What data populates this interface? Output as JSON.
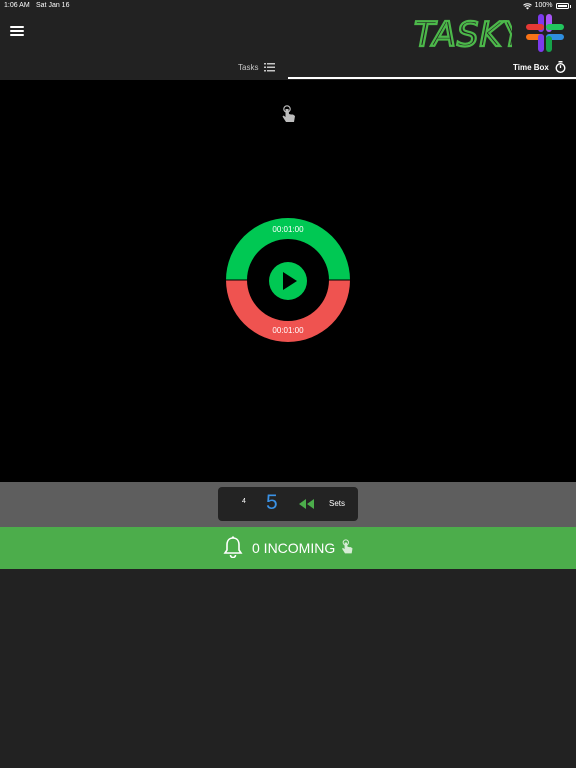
{
  "status_bar": {
    "time": "1:06 AM",
    "date": "Sat Jan 16",
    "battery": "100%"
  },
  "header": {
    "menu_icon": "hamburger-menu-icon",
    "logo_text": "TASKY",
    "logo_icon": "colorful-hash-logo-icon"
  },
  "tabs": [
    {
      "label": "Tasks",
      "icon": "list-icon",
      "selected": false
    },
    {
      "label": "Time Box",
      "icon": "stopwatch-icon",
      "selected": true
    }
  ],
  "timer": {
    "top_time": "00:01:00",
    "bottom_time": "00:01:00",
    "top_color": "#00c853",
    "bottom_color": "#ef5350",
    "play_icon": "play-icon",
    "tap_hint_icon": "tap-hand-icon"
  },
  "sets": {
    "previous": "4",
    "current": "5",
    "label": "Sets",
    "rewind_icon": "rewind-icon"
  },
  "incoming": {
    "text": "0 INCOMING",
    "bell_icon": "bell-icon",
    "tap_icon": "tap-hand-icon",
    "color": "#4cad4b"
  }
}
